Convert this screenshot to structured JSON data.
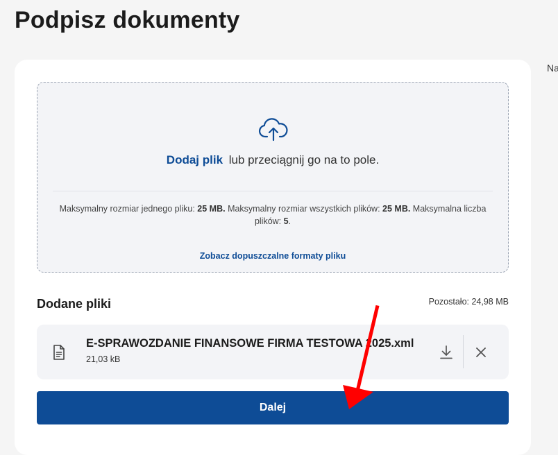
{
  "page": {
    "title": "Podpisz dokumenty",
    "side_text": "Na"
  },
  "dropzone": {
    "icon": "cloud-upload-icon",
    "add_link": "Dodaj plik",
    "drag_text": "lub przeciągnij go na to pole.",
    "limits": {
      "part1": "Maksymalny rozmiar jednego pliku: ",
      "size_single": "25 MB.",
      "part2": " Maksymalny rozmiar wszystkich plików: ",
      "size_total": "25 MB.",
      "part3": " Maksymalna liczba plików: ",
      "max_files": "5",
      "part4": "."
    },
    "formats_link": "Zobacz dopuszczalne formaty pliku"
  },
  "files": {
    "heading": "Dodane pliki",
    "remaining": "Pozostało: 24,98 MB",
    "items": [
      {
        "name": "E-SPRAWOZDANIE FINANSOWE FIRMA TESTOWA 2025.xml",
        "size": "21,03 kB",
        "icon": "document-icon"
      }
    ]
  },
  "actions": {
    "next_label": "Dalej"
  },
  "colors": {
    "accent": "#0e4c96",
    "annotation_arrow": "#ff0000",
    "background": "#f5f5f5"
  }
}
